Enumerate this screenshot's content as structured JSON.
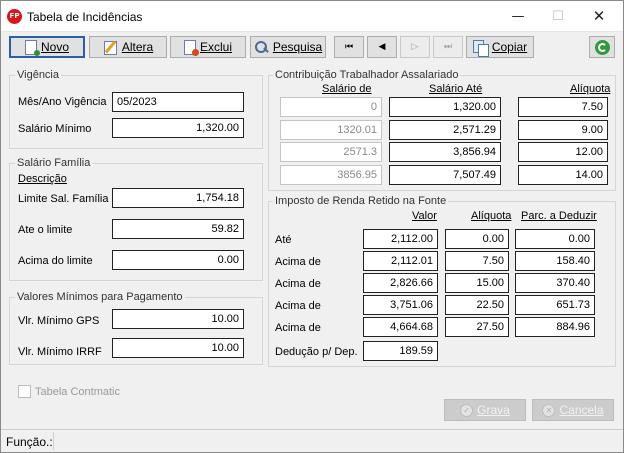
{
  "window": {
    "title": "Tabela de Incidências",
    "icon_text": "FP"
  },
  "toolbar": {
    "novo": "Novo",
    "altera": "Altera",
    "exclui": "Exclui",
    "pesquisa": "Pesquisa",
    "copiar": "Copiar",
    "nav_first": "⏮",
    "nav_prev": "◀",
    "nav_next": "▷",
    "nav_last": "⏭"
  },
  "vigencia": {
    "title": "Vigência",
    "mes_ano_label": "Mês/Ano Vigência",
    "mes_ano_value": "05/2023",
    "salario_minimo_label": "Salário Mínimo",
    "salario_minimo_value": "1,320.00"
  },
  "salario_familia": {
    "title": "Salário Família",
    "descricao_header": "Descrição",
    "limite_label": "Limite Sal. Família",
    "limite_value": "1,754.18",
    "ate_limite_label": "Ate o limite",
    "ate_limite_value": "59.82",
    "acima_limite_label": "Acima do limite",
    "acima_limite_value": "0.00"
  },
  "valores_minimos": {
    "title": "Valores Mínimos para Pagamento",
    "gps_label": "Vlr. Mínimo GPS",
    "gps_value": "10.00",
    "irrf_label": "Vlr. Mínimo IRRF",
    "irrf_value": "10.00"
  },
  "contribuicao": {
    "title": "Contribuição Trabalhador Assalariado",
    "headers": {
      "salario_de": "Salário de",
      "salario_ate": "Salário Até",
      "aliquota": "Alíquota"
    },
    "rows": [
      {
        "de": "0",
        "ate": "1,320.00",
        "aliquota": "7.50"
      },
      {
        "de": "1320.01",
        "ate": "2,571.29",
        "aliquota": "9.00"
      },
      {
        "de": "2571.3",
        "ate": "3,856.94",
        "aliquota": "12.00"
      },
      {
        "de": "3856.95",
        "ate": "7,507.49",
        "aliquota": "14.00"
      }
    ]
  },
  "irrf": {
    "title": "Imposto de Renda Retido na Fonte",
    "headers": {
      "valor": "Valor",
      "aliquota": "Alíquota",
      "parcela": "Parc. a Deduzir"
    },
    "rows": [
      {
        "label": "Até",
        "valor": "2,112.00",
        "aliquota": "0.00",
        "parcela": "0.00"
      },
      {
        "label": "Acima de",
        "valor": "2,112.01",
        "aliquota": "7.50",
        "parcela": "158.40"
      },
      {
        "label": "Acima de",
        "valor": "2,826.66",
        "aliquota": "15.00",
        "parcela": "370.40"
      },
      {
        "label": "Acima de",
        "valor": "3,751.06",
        "aliquota": "22.50",
        "parcela": "651.73"
      },
      {
        "label": "Acima de",
        "valor": "4,664.68",
        "aliquota": "27.50",
        "parcela": "884.96"
      }
    ],
    "deducao_label": "Dedução p/ Dep.",
    "deducao_value": "189.59"
  },
  "footer": {
    "tabela_contmatic_label": "Tabela Contmatic",
    "grava": "Grava",
    "cancela": "Cancela",
    "status_label": "Função.:"
  }
}
